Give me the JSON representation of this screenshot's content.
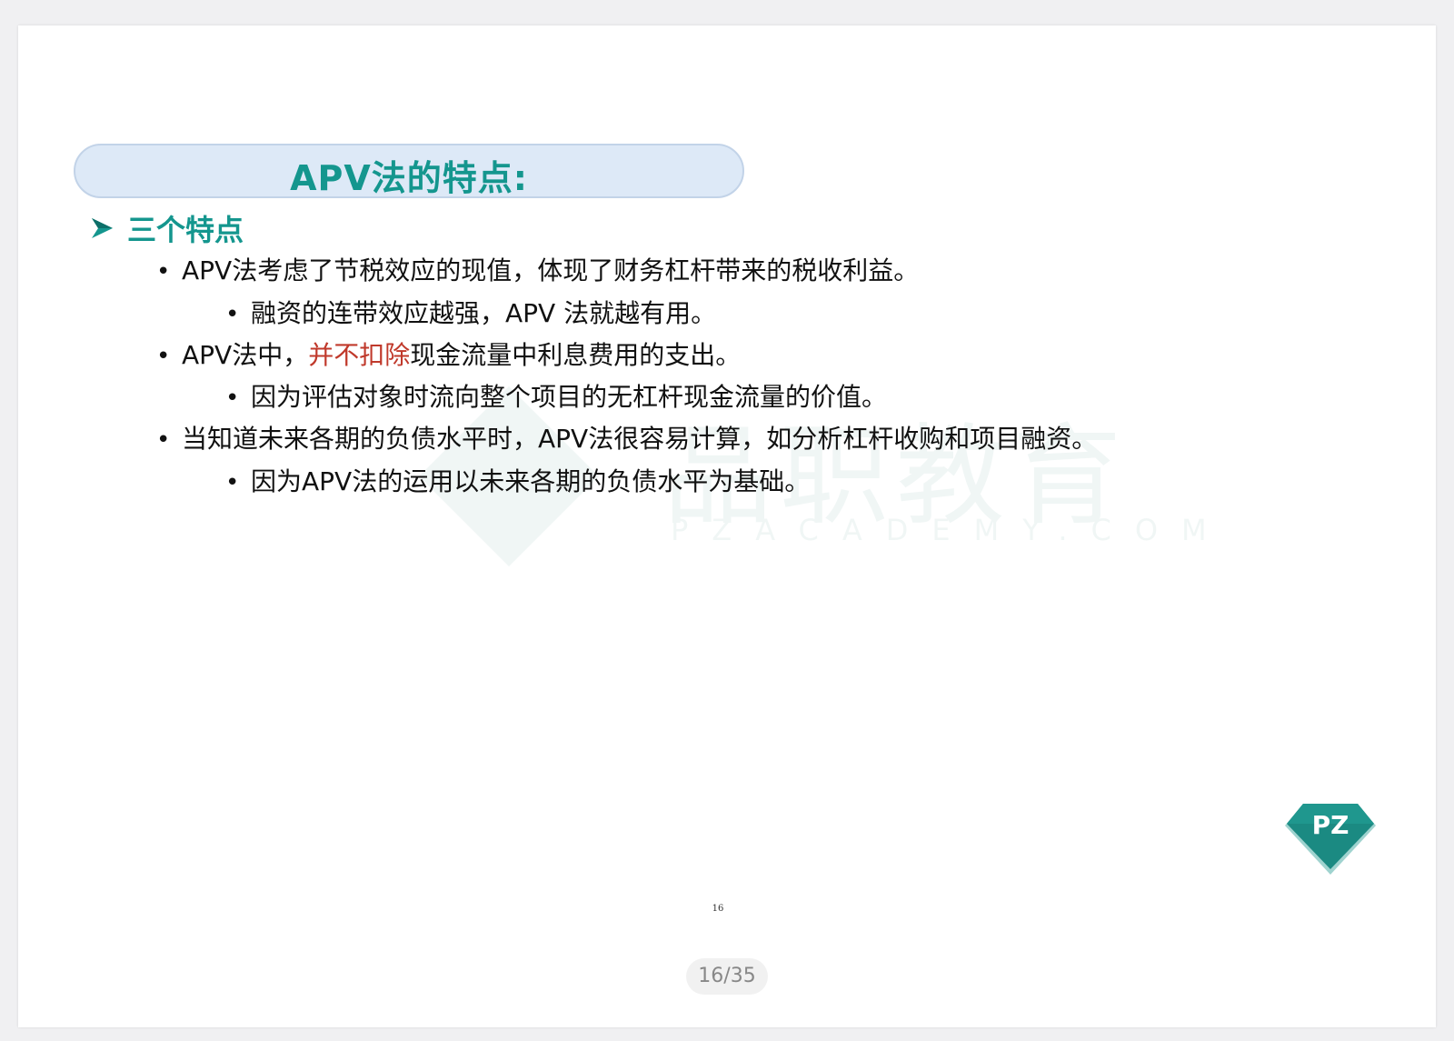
{
  "slide": {
    "title": "APV法的特点:",
    "section": "三个特点",
    "bullets": [
      {
        "text": "APV法考虑了节税效应的现值，体现了财务杠杆带来的税收利益。",
        "sub": "融资的连带效应越强，APV 法就越有用。"
      },
      {
        "pre": "APV法中，",
        "highlight": "并不扣除",
        "post": "现金流量中利息费用的支出。",
        "sub": "因为评估对象时流向整个项目的无杠杆现金流量的价值。"
      },
      {
        "text": "当知道未来各期的负债水平时，APV法很容易计算，如分析杠杆收购和项目融资。",
        "sub": "因为APV法的运用以未来各期的负债水平为基础。"
      }
    ],
    "bullet_glyph": "•",
    "watermark": {
      "text": "品职教育",
      "sub": "PZACADEMY.COM"
    },
    "logo_text": "PZ",
    "slide_number": "16"
  },
  "viewer": {
    "page_indicator": "16/35"
  },
  "colors": {
    "accent_teal": "#14968e",
    "highlight_red": "#c0392b",
    "title_pill_bg": "#dde9f7",
    "logo_teal": "#1b8a82"
  }
}
